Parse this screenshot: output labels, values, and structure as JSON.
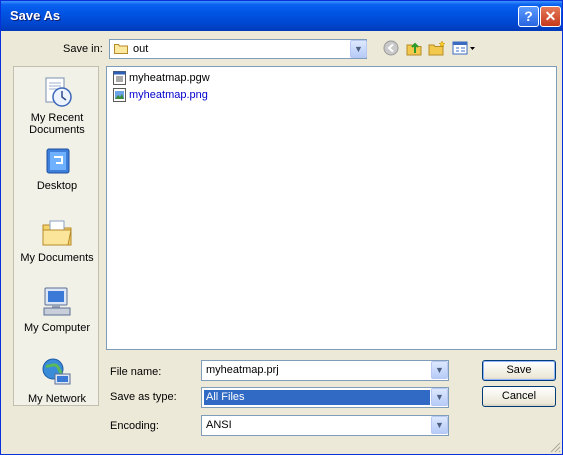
{
  "window": {
    "title": "Save As",
    "help_glyph": "?",
    "close_glyph": "✕"
  },
  "toolbar": {
    "save_in_label": "Save in:",
    "save_in_value": "out",
    "icons": [
      "back-icon",
      "up-folder-icon",
      "new-folder-icon",
      "view-menu-icon"
    ]
  },
  "places": [
    {
      "label": "My Recent Documents",
      "icon": "recent-documents-icon"
    },
    {
      "label": "Desktop",
      "icon": "desktop-icon"
    },
    {
      "label": "My Documents",
      "icon": "my-documents-icon"
    },
    {
      "label": "My Computer",
      "icon": "my-computer-icon"
    },
    {
      "label": "My Network",
      "icon": "network-icon"
    }
  ],
  "files": [
    {
      "name": "myheatmap.pgw",
      "icon": "text-file-icon",
      "color": "#000000"
    },
    {
      "name": "myheatmap.png",
      "icon": "image-file-icon",
      "color": "#0000cc"
    }
  ],
  "form": {
    "file_name_label": "File name:",
    "file_name_value": "myheatmap.prj",
    "save_type_label": "Save as type:",
    "save_type_value": "All Files",
    "encoding_label": "Encoding:",
    "encoding_value": "ANSI"
  },
  "buttons": {
    "save": "Save",
    "cancel": "Cancel"
  },
  "colors": {
    "titlebar": "#0054e3",
    "selection": "#316ac5",
    "link_file": "#0000cc"
  }
}
